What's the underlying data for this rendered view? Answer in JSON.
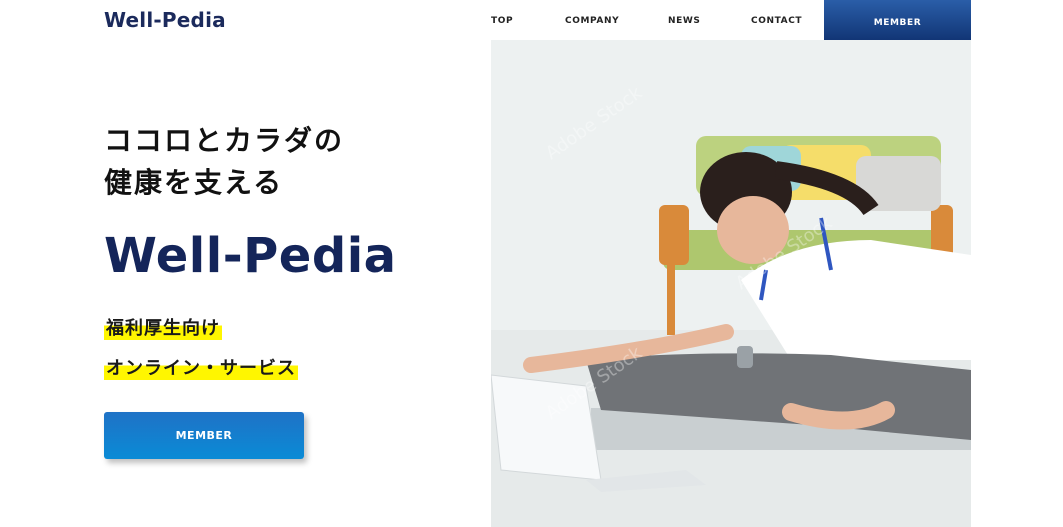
{
  "header": {
    "logo": "Well-Pedia",
    "nav": [
      "TOP",
      "COMPANY",
      "NEWS",
      "CONTACT"
    ],
    "member_label": "MEMBER"
  },
  "hero": {
    "headline_line1": "ココロとカラダの",
    "headline_line2": "健康を支える",
    "brand": "Well-Pedia",
    "tag1": "福利厚生向け",
    "tag2": "オンライン・サービス",
    "cta_label": "MEMBER",
    "image_watermark": "Adobe Stock"
  },
  "colors": {
    "brand_navy": "#14255a",
    "member_nav_bg": "#1a3f85",
    "cta_blue": "#1577cd",
    "highlight_yellow": "#fff600"
  }
}
